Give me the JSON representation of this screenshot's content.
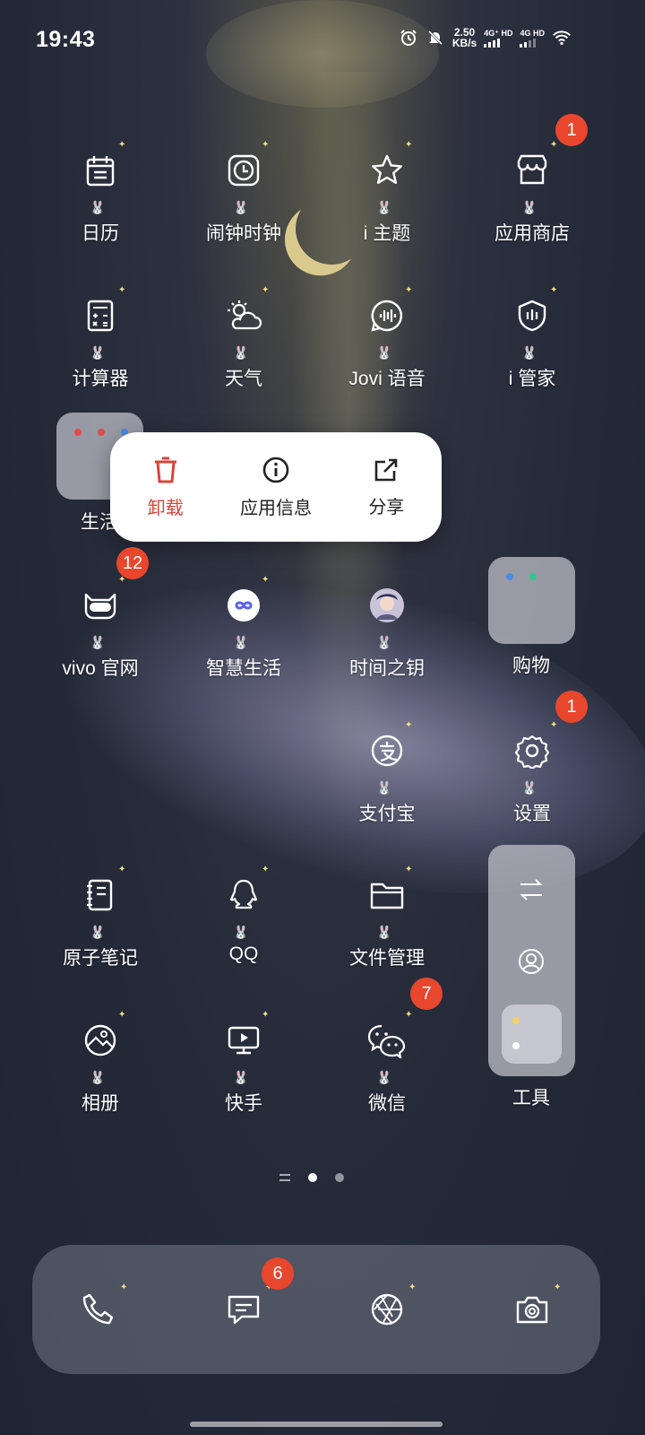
{
  "status_bar": {
    "time": "19:43",
    "speed_value": "2.50",
    "speed_unit": "KB/s",
    "sim1": "4G⁺ HD",
    "sim2": "4G HD"
  },
  "apps": {
    "calendar": "日历",
    "clock": "闹钟时钟",
    "theme": "i 主题",
    "appstore": "应用商店",
    "calculator": "计算器",
    "weather": "天气",
    "jovi": "Jovi 语音",
    "manager": "i 管家",
    "life_folder": "生活",
    "vivo": "vivo 官网",
    "smartlife": "智慧生活",
    "timekey": "时间之钥",
    "shopping": "购物",
    "alipay": "支付宝",
    "settings": "设置",
    "notes": "原子笔记",
    "qq": "QQ",
    "files": "文件管理",
    "tools": "工具",
    "album": "相册",
    "kuaishou": "快手",
    "wechat": "微信"
  },
  "badges": {
    "appstore": "1",
    "vivo": "12",
    "settings": "1",
    "wechat": "7",
    "messages": "6"
  },
  "context_menu": {
    "uninstall": "卸载",
    "app_info": "应用信息",
    "share": "分享"
  },
  "colors": {
    "badge": "#e8462d",
    "danger": "#d6453d"
  }
}
